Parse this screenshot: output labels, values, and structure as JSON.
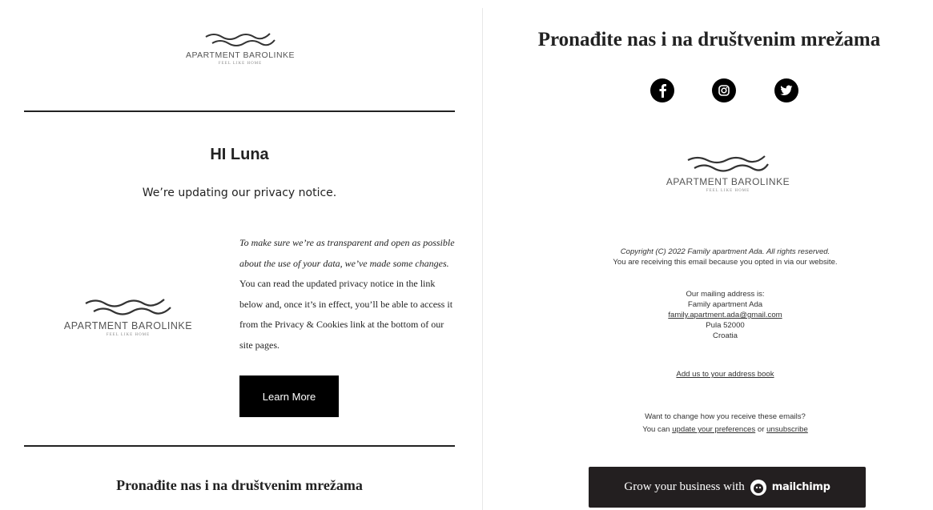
{
  "left": {
    "logo": {
      "brand": "APARTMENT BAROLINKE",
      "tagline": "FEEL LIKE HOME"
    },
    "greeting": "HI Luna",
    "subheading": "We’re updating our privacy notice.",
    "body": {
      "italic": "To make sure we’re as transparent and open as possible about the use of your data, we’ve made some changes.",
      "regular": " You can read the updated privacy notice in the link below and, once it’s in effect, you’ll be able to access it from the Privacy & Cookies link at the bottom of our site pages."
    },
    "learn_more_label": "Learn More",
    "social_heading": "Pronađite nas i na društvenim mrežama"
  },
  "right": {
    "social_heading": "Pronađite nas i na društvenim mrežama",
    "social_icons": [
      "facebook-icon",
      "instagram-icon",
      "twitter-icon"
    ],
    "logo": {
      "brand": "APARTMENT BAROLINKE",
      "tagline": "FEEL LIKE HOME"
    },
    "copyright": "Copyright (C) 2022 Family apartment Ada. All rights reserved.",
    "opted_in": "You are receiving this email because you opted in via our website.",
    "mailing_label": "Our mailing address is:",
    "address_name": "Family apartment Ada",
    "address_email": "family.apartment.ada@gmail.com",
    "address_city": "Pula 52000",
    "address_country": "Croatia",
    "add_address_book": "Add us to your address book",
    "change_prompt": "Want to change how you receive these emails?",
    "you_can": "You can ",
    "update_preferences": "update your preferences",
    "or": " or ",
    "unsubscribe": "unsubscribe",
    "badge_text": "Grow your business with",
    "badge_brand": "mailchimp"
  },
  "colors": {
    "text": "#222222",
    "button": "#000000",
    "badge": "#231f20"
  }
}
